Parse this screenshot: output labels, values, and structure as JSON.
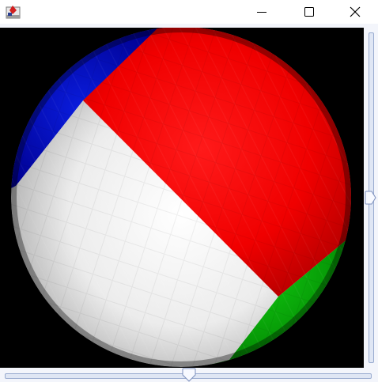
{
  "window": {
    "title": "",
    "icon": "java-app-icon",
    "controls": {
      "minimize": "minimize-icon",
      "maximize": "maximize-icon",
      "close": "close-icon"
    }
  },
  "scene": {
    "background": "#000000",
    "object": "sphere",
    "segments": [
      {
        "name": "red",
        "color": "#ff0000"
      },
      {
        "name": "white",
        "color": "#ffffff"
      },
      {
        "name": "blue",
        "color": "#0000d0"
      },
      {
        "name": "green",
        "color": "#00c000"
      }
    ]
  },
  "sliders": {
    "vertical": {
      "value_fraction": 0.5
    },
    "horizontal": {
      "value_fraction": 0.5
    }
  }
}
